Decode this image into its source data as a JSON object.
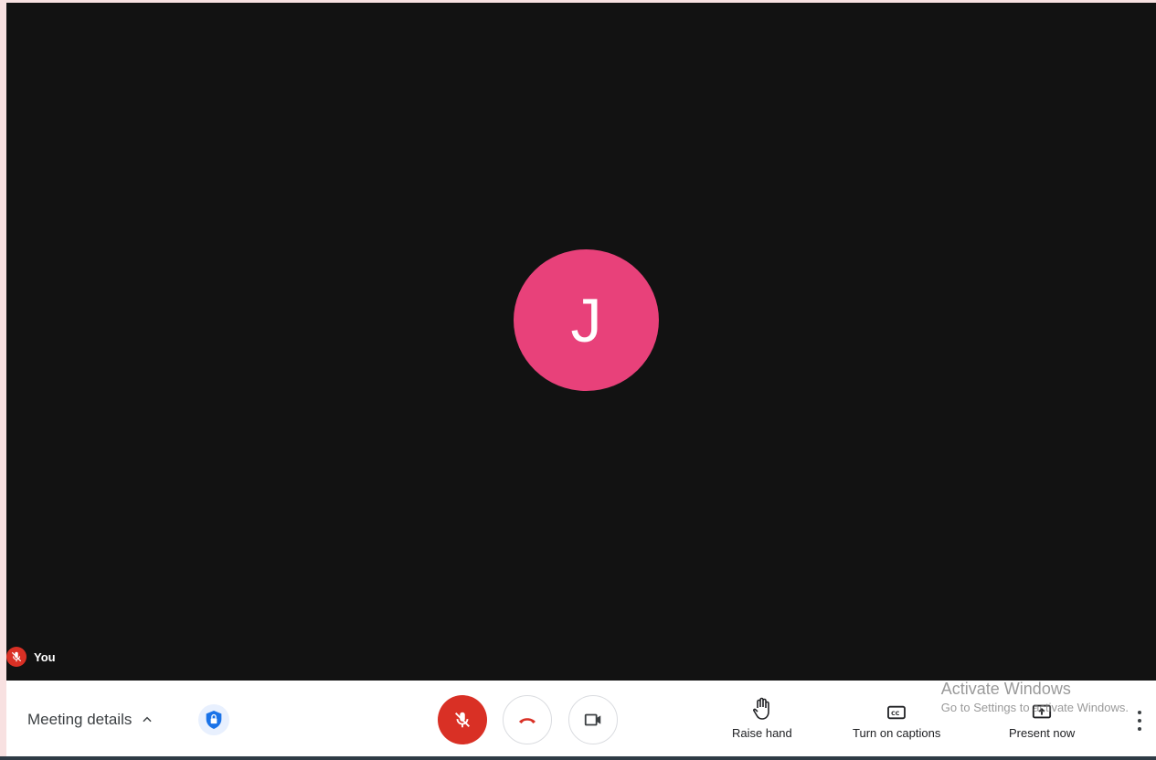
{
  "participant": {
    "initial": "J",
    "avatar_color": "#e8417a"
  },
  "self_tile": {
    "name": "You"
  },
  "toolbar": {
    "meeting_details_label": "Meeting details",
    "actions": [
      {
        "label": "Raise hand",
        "icon": "raise-hand-icon"
      },
      {
        "label": "Turn on captions",
        "icon": "captions-icon"
      },
      {
        "label": "Present now",
        "icon": "present-icon"
      }
    ]
  },
  "watermark": {
    "title": "Activate Windows",
    "subtitle": "Go to Settings to activate Windows."
  },
  "colors": {
    "mute_red": "#d93025",
    "accent_blue": "#1a73e8",
    "stage": "#121212"
  }
}
